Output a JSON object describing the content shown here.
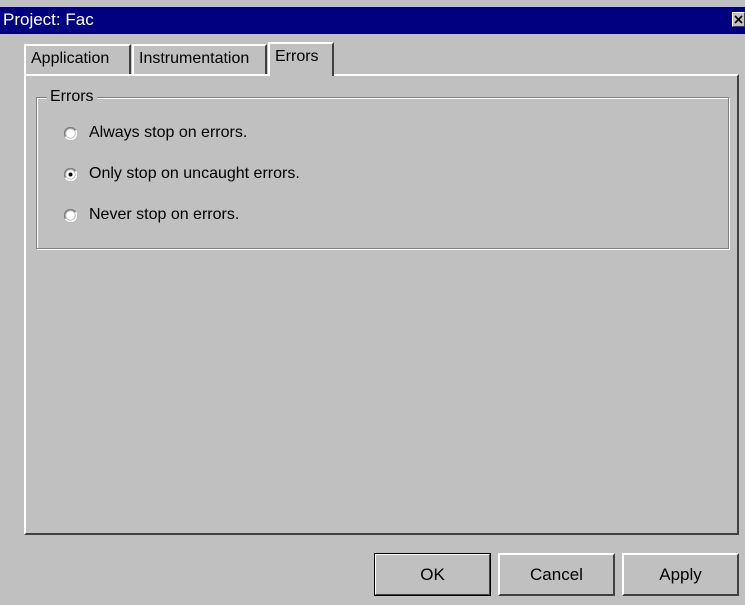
{
  "window": {
    "title": "Project: Fac",
    "close_icon": "close-icon"
  },
  "tabs": [
    {
      "label": "Application",
      "active": false
    },
    {
      "label": "Instrumentation",
      "active": false
    },
    {
      "label": "Errors",
      "active": true
    }
  ],
  "errors_group": {
    "legend": "Errors",
    "options": [
      {
        "label": "Always stop on errors.",
        "selected": false
      },
      {
        "label": "Only stop on uncaught errors.",
        "selected": true
      },
      {
        "label": "Never stop on errors.",
        "selected": false
      }
    ]
  },
  "buttons": {
    "ok_label": "OK",
    "cancel_label": "Cancel",
    "apply_label": "Apply"
  },
  "colors": {
    "title_bar": "#000080",
    "face": "#c0c0c0",
    "highlight": "#ffffff",
    "shadow": "#404040"
  }
}
